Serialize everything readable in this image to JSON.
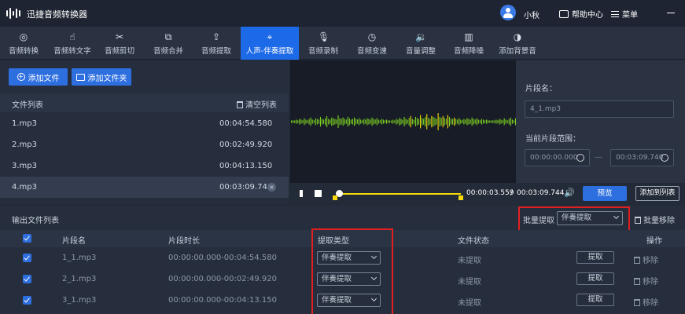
{
  "app": {
    "title": "迅捷音频转换器",
    "username": "小秋",
    "help_label": "帮助中心",
    "menu_label": "菜单"
  },
  "toolbar": [
    {
      "label": "音频转换",
      "icon": "audio-convert-icon",
      "glyph": "◎"
    },
    {
      "label": "音频转文字",
      "icon": "speech-to-text-icon",
      "glyph": "☝"
    },
    {
      "label": "音频剪切",
      "icon": "scissors-icon",
      "glyph": "✂"
    },
    {
      "label": "音频合并",
      "icon": "merge-icon",
      "glyph": "⧉"
    },
    {
      "label": "音频提取",
      "icon": "extract-icon",
      "glyph": "⇪"
    },
    {
      "label": "人声-伴奏提取",
      "icon": "vocal-separate-icon",
      "glyph": "⌖",
      "active": true
    },
    {
      "label": "音频录制",
      "icon": "microphone-icon",
      "glyph": "🎙"
    },
    {
      "label": "音频变速",
      "icon": "speed-icon",
      "glyph": "◷"
    },
    {
      "label": "音量调整",
      "icon": "volume-icon",
      "glyph": "🔉"
    },
    {
      "label": "音频降噪",
      "icon": "denoise-icon",
      "glyph": "▥"
    },
    {
      "label": "添加背景音",
      "icon": "add-bgm-icon",
      "glyph": "◑"
    }
  ],
  "left_panel": {
    "add_file_label": "添加文件",
    "add_folder_label": "添加文件夹",
    "list_title": "文件列表",
    "clear_label": "清空列表",
    "files": [
      {
        "name": "1.mp3",
        "duration": "00:04:54.580"
      },
      {
        "name": "2.mp3",
        "duration": "00:02:49.920"
      },
      {
        "name": "3.mp3",
        "duration": "00:04:13.150"
      },
      {
        "name": "4.mp3",
        "duration": "00:03:09.740",
        "selected": true
      }
    ]
  },
  "player": {
    "current_time": "00:00:03.559",
    "separator": "/",
    "total_time": "00:03:09.744",
    "preview_label": "预览",
    "add_to_list_label": "添加到列表",
    "progress": 0.02
  },
  "segment": {
    "name_label": "片段名：",
    "name_value": "4_1.mp3",
    "range_label": "当前片段范围：",
    "start": "00:00:00.000",
    "range_separator": "—",
    "end": "00:03:09.740"
  },
  "output": {
    "title": "输出文件列表",
    "batch_label": "批量提取",
    "batch_value": "伴奏提取",
    "batch_remove_label": "批量移除",
    "headers": {
      "segment_name": "片段名",
      "segment_duration": "片段时长",
      "extract_type": "提取类型",
      "file_status": "文件状态",
      "operation": "操作"
    },
    "rows": [
      {
        "name": "1_1.mp3",
        "duration": "00:00:00.000-00:04:54.580",
        "type": "伴奏提取",
        "status": "未提取",
        "extract_label": "提取",
        "remove_label": "移除"
      },
      {
        "name": "2_1.mp3",
        "duration": "00:00:00.000-00:02:49.920",
        "type": "伴奏提取",
        "status": "未提取",
        "extract_label": "提取",
        "remove_label": "移除"
      },
      {
        "name": "3_1.mp3",
        "duration": "00:00:00.000-00:04:13.150",
        "type": "伴奏提取",
        "status": "未提取",
        "extract_label": "提取",
        "remove_label": "移除"
      }
    ]
  },
  "colors": {
    "accent": "#2e6fe0",
    "waveform": "#7ed321",
    "trim_marker": "#f5d90a",
    "highlight_box": "#e02020"
  }
}
